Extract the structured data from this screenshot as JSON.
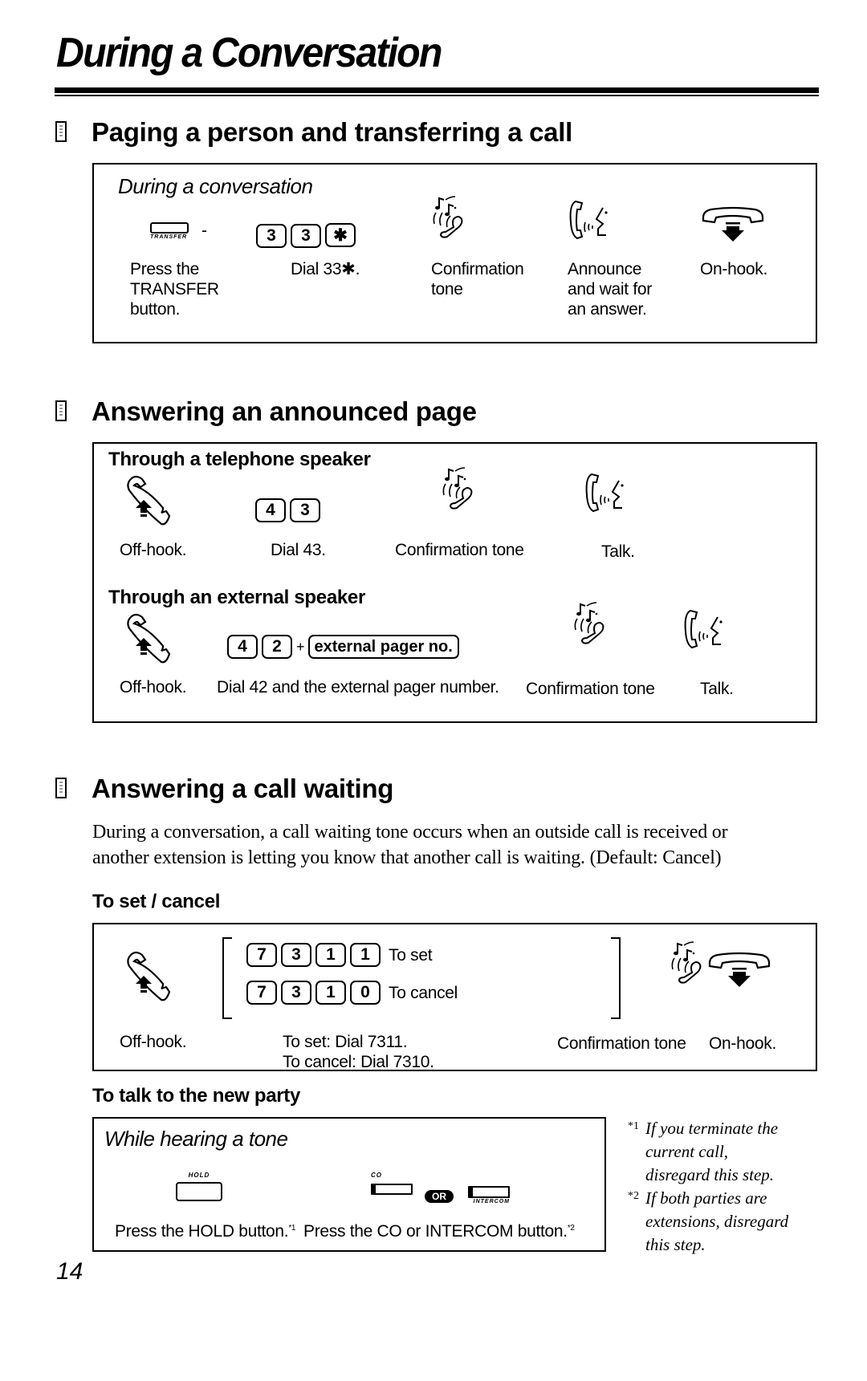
{
  "page": {
    "title": "During a Conversation",
    "page_number": "14"
  },
  "section1": {
    "title": "Paging a person and transferring a call",
    "subtitle": "During a conversation",
    "transfer_caption": "TRANSFER",
    "dash": "-",
    "keys": [
      "3",
      "3",
      "✱"
    ],
    "steps": [
      {
        "icon": "transfer-button-icon",
        "label": "Press the TRANSFER button."
      },
      {
        "icon": "dial-keys",
        "label": "Dial 33✱."
      },
      {
        "icon": "confirmation-tone-icon",
        "label": "Confirmation tone"
      },
      {
        "icon": "talk-icon",
        "label": "Announce and wait for an answer."
      },
      {
        "icon": "on-hook-icon",
        "label": "On-hook."
      }
    ]
  },
  "section2": {
    "title": "Answering an announced page",
    "phone_speaker": {
      "subtitle": "Through a telephone speaker",
      "keys": [
        "4",
        "3"
      ],
      "steps": [
        {
          "icon": "off-hook-icon",
          "label": "Off-hook."
        },
        {
          "icon": "dial-keys",
          "label": "Dial 43."
        },
        {
          "icon": "confirmation-tone-icon",
          "label": "Confirmation tone"
        },
        {
          "icon": "talk-icon",
          "label": "Talk."
        }
      ]
    },
    "external_speaker": {
      "subtitle": "Through an external speaker",
      "keys": [
        "4",
        "2"
      ],
      "plus": "+",
      "pager_key": "external pager no.",
      "steps": [
        {
          "icon": "off-hook-icon",
          "label": "Off-hook."
        },
        {
          "icon": "dial-keys",
          "label": "Dial 42 and the external pager number."
        },
        {
          "icon": "confirmation-tone-icon",
          "label": "Confirmation tone"
        },
        {
          "icon": "talk-icon",
          "label": "Talk."
        }
      ]
    }
  },
  "section3": {
    "title": "Answering a call waiting",
    "body_line1": "During a conversation, a call waiting tone occurs when an outside call is received or",
    "body_line2": "another extension is letting you know that another call is waiting. (Default: Cancel)",
    "set_cancel": {
      "heading": "To set / cancel",
      "set_keys": [
        "7",
        "3",
        "1",
        "1"
      ],
      "set_label": "To set",
      "cancel_keys": [
        "7",
        "3",
        "1",
        "0"
      ],
      "cancel_label": "To cancel",
      "offhook_label": "Off-hook.",
      "dial_set": "To set: Dial 7311.",
      "dial_cancel": "To cancel: Dial 7310.",
      "tone_label": "Confirmation tone",
      "onhook_label": "On-hook."
    },
    "new_party": {
      "heading": "To talk to the new party",
      "subtitle": "While hearing a tone",
      "hold_caption": "HOLD",
      "co_caption": "CO",
      "or_badge": "OR",
      "intercom_caption": "INTERCOM",
      "hold_label": "Press the HOLD button.",
      "hold_note": "*1",
      "co_label": "Press the CO or INTERCOM button.",
      "co_note": "*2"
    },
    "footnotes": [
      {
        "mark": "*1",
        "lines": [
          "If you terminate the",
          "current call,",
          "disregard this step."
        ]
      },
      {
        "mark": "*2",
        "lines": [
          "If both parties are",
          "extensions, disregard",
          "this step."
        ]
      }
    ]
  }
}
